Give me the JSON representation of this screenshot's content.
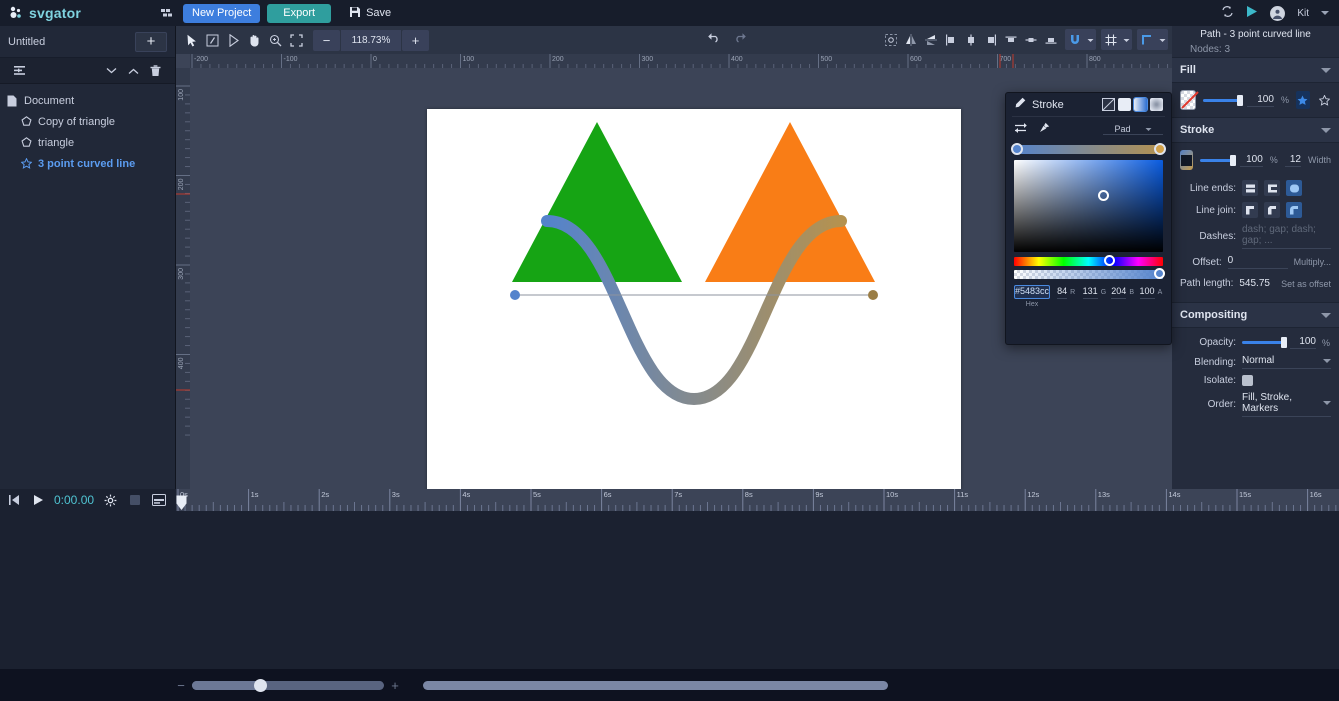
{
  "header": {
    "brand": "svgator",
    "grid_icon": "grid-icon",
    "new_project_label": "New Project",
    "export_label": "Export",
    "save_label": "Save",
    "save_icon": "save-disk-icon",
    "sync_icon": "sync-icon",
    "play_icon": "play-icon",
    "user_name": "Kit",
    "user_icon": "avatar-icon",
    "caret_icon": "chevron-down-icon"
  },
  "left_panel": {
    "project_name": "Untitled",
    "add_label": "+",
    "tools": {
      "list_icon": "list-options-icon",
      "collapse_down_icon": "chevron-down-icon",
      "collapse_up_icon": "chevron-up-icon",
      "delete_icon": "trash-icon"
    },
    "layers": [
      {
        "label": "Document",
        "icon": "document-icon",
        "selected": false,
        "depth": 0
      },
      {
        "label": "Copy of triangle",
        "icon": "pentagon-icon",
        "selected": false,
        "depth": 1
      },
      {
        "label": "triangle",
        "icon": "pentagon-icon",
        "selected": false,
        "depth": 1
      },
      {
        "label": "3 point curved line",
        "icon": "star-path-icon",
        "selected": true,
        "depth": 1
      }
    ]
  },
  "toolbar": {
    "tools": [
      "select-arrow-icon",
      "transform-icon",
      "pen-node-icon",
      "hand-icon",
      "zoom-icon",
      "fit-screen-icon"
    ],
    "zoom_out_label": "−",
    "zoom_value": "118.73%",
    "zoom_in_label": "+",
    "undo_icon": "undo-icon",
    "redo_icon": "redo-icon",
    "align_tools": [
      "align-nodes-icon",
      "flip-horizontal-icon",
      "flip-vertical-icon",
      "align-left-icon",
      "align-center-h-icon",
      "align-right-icon",
      "align-top-icon",
      "align-middle-v-icon",
      "align-bottom-icon"
    ],
    "group_buttons": [
      {
        "icon": "magnet-snap-icon",
        "active": true
      },
      {
        "icon": "grid-snap-icon",
        "active": false
      },
      {
        "icon": "guides-icon",
        "active": false
      }
    ]
  },
  "canvas": {
    "ruler_h_labels": [
      "-200",
      "-100",
      "0",
      "100",
      "200",
      "300",
      "400",
      "500",
      "600",
      "700",
      "800"
    ],
    "ruler_v_labels": [
      "100",
      "200",
      "300",
      "400"
    ],
    "shapes": {
      "triangle_left_color": "#16a414",
      "triangle_right_color": "#f97d16",
      "path_gradient_start": "#5483cc",
      "path_gradient_end": "#b5924f",
      "path_stroke_width": "12",
      "node_start_color": "#5483cc",
      "node_end_color": "#9a7d45",
      "guide_line_color": "#8d939f"
    }
  },
  "picker": {
    "title": "Stroke",
    "title_icon": "pencil-icon",
    "modes": [
      {
        "name": "no-paint",
        "selected": false
      },
      {
        "name": "solid-paint",
        "selected": false
      },
      {
        "name": "linear-gradient-paint",
        "selected": true
      },
      {
        "name": "radial-gradient-paint",
        "selected": false
      }
    ],
    "swap_icon": "swap-stops-icon",
    "pin_icon": "pin-icon",
    "spread_label": "Pad",
    "gradient_start": "#5483cc",
    "gradient_end": "#b5924f",
    "fields": [
      {
        "key": "Hex",
        "value": "#5483cc"
      },
      {
        "key": "R",
        "value": "84"
      },
      {
        "key": "G",
        "value": "131"
      },
      {
        "key": "B",
        "value": "204"
      },
      {
        "key": "A",
        "value": "100"
      }
    ]
  },
  "properties": {
    "title": "Path - 3 point curved line",
    "nodes_label": "Nodes:",
    "nodes_value": "3",
    "fill": {
      "section": "Fill",
      "swatch": "none-checker-swatch",
      "opacity": "100",
      "opacity_unit": "%",
      "star_filled_icon": "star-filled-icon",
      "star_outline_icon": "star-outline-icon"
    },
    "stroke": {
      "section": "Stroke",
      "swatch": "gradient-swatch",
      "opacity": "100",
      "opacity_unit": "%",
      "width_value": "12",
      "width_label": "Width",
      "line_ends_label": "Line ends:",
      "line_ends": [
        {
          "icon": "cap-butt-icon",
          "active": false
        },
        {
          "icon": "cap-square-icon",
          "active": false
        },
        {
          "icon": "cap-round-icon",
          "active": true
        }
      ],
      "line_join_label": "Line join:",
      "line_join": [
        {
          "icon": "join-miter-icon",
          "active": false
        },
        {
          "icon": "join-bevel-icon",
          "active": false
        },
        {
          "icon": "join-round-icon",
          "active": true
        }
      ],
      "dashes_label": "Dashes:",
      "dashes_placeholder": "dash; gap; dash; gap; ...",
      "offset_label": "Offset:",
      "offset_value": "0",
      "multiply_label": "Multiply...",
      "path_length_label": "Path length:",
      "path_length_value": "545.75",
      "set_as_offset_label": "Set as offset"
    },
    "compositing": {
      "section": "Compositing",
      "opacity_label": "Opacity:",
      "opacity_value": "100",
      "opacity_unit": "%",
      "blending_label": "Blending:",
      "blending_value": "Normal",
      "isolate_label": "Isolate:",
      "order_label": "Order:",
      "order_value": "Fill, Stroke, Markers"
    }
  },
  "timeline": {
    "start_icon": "skip-start-icon",
    "play_icon": "play-icon",
    "time": "0:00.00",
    "settings_icon": "gear-icon",
    "stop_icon": "stop-icon",
    "export_frame_icon": "frame-export-icon",
    "ruler_labels": [
      "0s",
      "1s",
      "2s",
      "3s",
      "4s",
      "5s",
      "6s",
      "7s",
      "8s",
      "9s",
      "10s",
      "11s",
      "12s",
      "13s",
      "14s",
      "15s",
      "16s"
    ],
    "playhead_position": "0s"
  },
  "bottom_bar": {
    "zoom_out_label": "−",
    "zoom_in_label": "+"
  },
  "colors": {
    "accent_blue": "#3d7ede",
    "accent_teal": "#2f9e9e",
    "panel_bg": "#252c3d",
    "header_bg": "#171d2b",
    "canvas_bg": "#3c4457",
    "selected_layer": "#5b9cf0"
  }
}
